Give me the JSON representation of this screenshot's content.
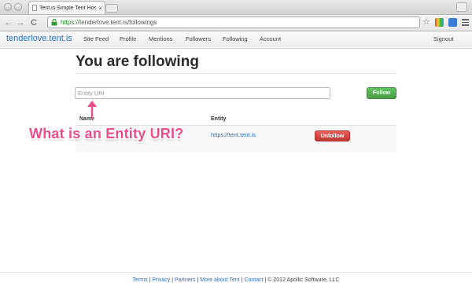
{
  "browser": {
    "tab_title": "Tent.is Simple Tent Hosting",
    "tab_close": "×",
    "url_scheme": "https://",
    "url_rest": "tenderlove.tent.is/followings",
    "back_glyph": "←",
    "forward_glyph": "→",
    "reload_glyph": "C",
    "star_glyph": "☆"
  },
  "site": {
    "brand": "tenderlove.tent.is",
    "nav": [
      "Site Feed",
      "Profile",
      "Mentions",
      "Followers",
      "Following",
      "Account"
    ],
    "signout": "Signout"
  },
  "main": {
    "title": "You are following",
    "input_placeholder": "Entity URI",
    "follow_label": "Follow",
    "columns": [
      "Name",
      "Entity"
    ],
    "rows": [
      {
        "name": "",
        "entity": "https://tent.tent.is",
        "action": "Unfollow"
      }
    ]
  },
  "annotation": {
    "text": "What is an Entity URI?",
    "color": "#ea4e8c"
  },
  "footer": {
    "links": [
      "Terms",
      "Privacy",
      "Partners",
      "More about Tent",
      "Contact"
    ],
    "separator": "|",
    "copyright": "© 2012 Apollic Software, LLC"
  },
  "icons": {
    "lock": "lock-icon",
    "star": "star-icon",
    "menu": "menu-icon"
  },
  "colors": {
    "link": "#2a6ebd",
    "follow_button": "#51a351",
    "unfollow_button": "#bd362f"
  }
}
